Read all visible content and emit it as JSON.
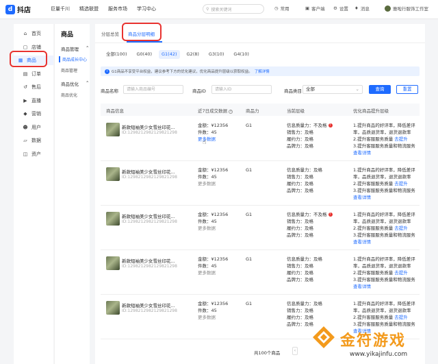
{
  "brand": {
    "name": "抖店"
  },
  "topnav": [
    "巨量千川",
    "精选联盟",
    "服务市场",
    "学习中心"
  ],
  "search": {
    "placeholder": "搜索关键词"
  },
  "top_right": {
    "item1": "常用",
    "item2": "客户端",
    "item3": "设置",
    "item4": "消息",
    "shop_name": "雅啦行服饰工作室"
  },
  "sidebar": [
    {
      "label": "首页",
      "icon": "home-icon"
    },
    {
      "label": "店铺",
      "icon": "shop-icon"
    },
    {
      "label": "商品",
      "icon": "product-icon",
      "active": true
    },
    {
      "label": "订单",
      "icon": "order-icon"
    },
    {
      "label": "售后",
      "icon": "after-sales-icon"
    },
    {
      "label": "直播",
      "icon": "live-icon"
    },
    {
      "label": "营销",
      "icon": "marketing-icon"
    },
    {
      "label": "用户",
      "icon": "user-icon"
    },
    {
      "label": "数据",
      "icon": "data-icon"
    },
    {
      "label": "资产",
      "icon": "asset-icon"
    }
  ],
  "subside": {
    "title": "商品",
    "group1": "商品管理",
    "item1": "商品成长中心",
    "item2": "商品管理",
    "group2": "商品优化",
    "item3": "商品优化"
  },
  "tabs": [
    "分层总览",
    "商品分层明细"
  ],
  "filters": [
    "全部(100)",
    "G0(40)",
    "G1(42)",
    "G2(8)",
    "G3(10)",
    "G4(10)"
  ],
  "banner": {
    "text": "G1商品不享受平台权益，建议参考下方的优化建议，优化商品提升层级以获取权益。",
    "link": "了解详情"
  },
  "form": {
    "name_label": "商品名称",
    "name_placeholder": "请输入商品编号",
    "id_label": "商品ID",
    "id_placeholder": "请输入ID",
    "category_label": "商品类目",
    "category_value": "全部",
    "search_button": "查询",
    "reset_button": "重置"
  },
  "table": {
    "headers": [
      "商品信息",
      "近7日成交数据",
      "商品力",
      "当前层级",
      "优化商品提升层级"
    ],
    "rows": [
      {
        "name": "新款短袖美少女雪丝印花...",
        "id": "ID:1298212982129821298",
        "amount": "金额：¥12356",
        "count": "件数：45",
        "more": "更多数据",
        "power": "G1",
        "quality": "信息质量力：不及格",
        "quality_err": true,
        "sales": "销售力：及格",
        "delivery": "履约力：及格",
        "brand": "品牌力：及格",
        "tip1": "1.提升商品的好评率，降低差评",
        "tip2": "率，品质退货率，退货退款率",
        "tip3": "2.提升客服服务质量",
        "tip3_link": "去提升",
        "tip4": "3.提升客服服务质量和物流服务",
        "detail": "查看详情"
      },
      {
        "name": "新款短袖美少女雪丝印花...",
        "id": "ID:1298212982129821298",
        "amount": "金额：¥12356",
        "count": "件数：45",
        "more": "更多数据",
        "power": "G1",
        "quality": "信息质量力：及格",
        "quality_err": false,
        "sales": "销售力：及格",
        "delivery": "履约力：及格",
        "brand": "品牌力：及格",
        "tip1": "1.提升商品的好评率，降低差评",
        "tip2": "率，品质退货率，退货退款率",
        "tip3": "2.提升客服服务质量",
        "tip3_link": "去提升",
        "tip4": "3.提升客服服务质量和物流服务",
        "detail": "查看详情"
      },
      {
        "name": "新款短袖美少女雪丝印花...",
        "id": "ID:1298212982129821298",
        "amount": "金额：¥12356",
        "count": "件数：45",
        "more": "更多数据",
        "power": "G1",
        "quality": "信息质量力：不及格",
        "quality_err": true,
        "sales": "销售力：及格",
        "delivery": "履约力：及格",
        "brand": "品牌力：及格",
        "tip1": "1.提升商品的好评率，降低差评",
        "tip2": "率，品质退货率，退货退款率",
        "tip3": "2.提升客服服务质量",
        "tip3_link": "去提升",
        "tip4": "3.提升客服服务质量和物流服务",
        "detail": "查看详情"
      },
      {
        "name": "新款短袖美少女雪丝印花...",
        "id": "ID:1298212982129821298",
        "amount": "金额：¥12356",
        "count": "件数：45",
        "more": "更多数据",
        "power": "G1",
        "quality": "信息质量力：及格",
        "quality_err": false,
        "sales": "销售力：及格",
        "delivery": "履约力：及格",
        "brand": "品牌力：及格",
        "tip1": "1.提升商品的好评率，降低差评",
        "tip2": "率，品质退货率，退货退款率",
        "tip3": "2.提升客服服务质量",
        "tip3_link": "去提升",
        "tip4": "3.提升客服服务质量和物流服务",
        "detail": "查看详情"
      },
      {
        "name": "新款短袖美少女雪丝印花...",
        "id": "ID:1298212982129821298",
        "amount": "金额：¥12356",
        "count": "件数：45",
        "more": "更多数据",
        "power": "G1",
        "quality": "信息质量力：及格",
        "quality_err": false,
        "sales": "销售力：及格",
        "delivery": "履约力：及格",
        "brand": "品牌力：及格",
        "tip1": "1.提升商品的好评率，降低差评",
        "tip2": "率，品质退货率，退货退款率",
        "tip3": "2.提升客服服务质量",
        "tip3_link": "去提升",
        "tip4": "3.提升客服服务质量和物流服务",
        "detail": "查看详情"
      }
    ]
  },
  "pager": {
    "total": "共100个商品"
  },
  "watermark": {
    "title": "金符游戏",
    "url": "www.yikajinfu.com"
  },
  "colors": {
    "accent": "#1e6bff",
    "highlight_box": "#e8322f",
    "watermark": "#f39a1c"
  }
}
